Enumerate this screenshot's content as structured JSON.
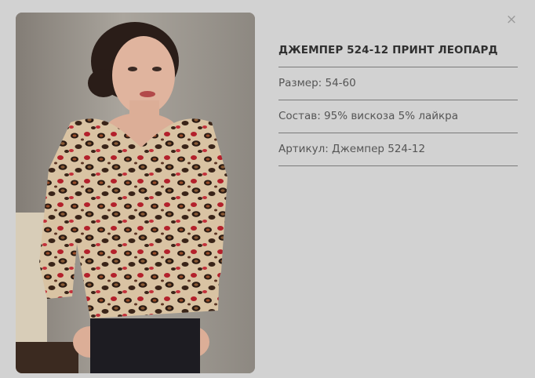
{
  "modal": {
    "close_glyph": "×",
    "product": {
      "title": "ДЖЕМПЕР 524-12 ПРИНТ ЛЕОПАРД",
      "size": "Размер: 54-60",
      "composition": "Состав: 95% вискоза 5% лайкра",
      "article": "Артикул: Джемпер 524-12"
    },
    "photo": {
      "icon": "product-photo"
    }
  },
  "colors": {
    "background": "#d2d2d2",
    "divider": "#7a7a7a",
    "title": "#2f2f2f",
    "text": "#555555"
  }
}
